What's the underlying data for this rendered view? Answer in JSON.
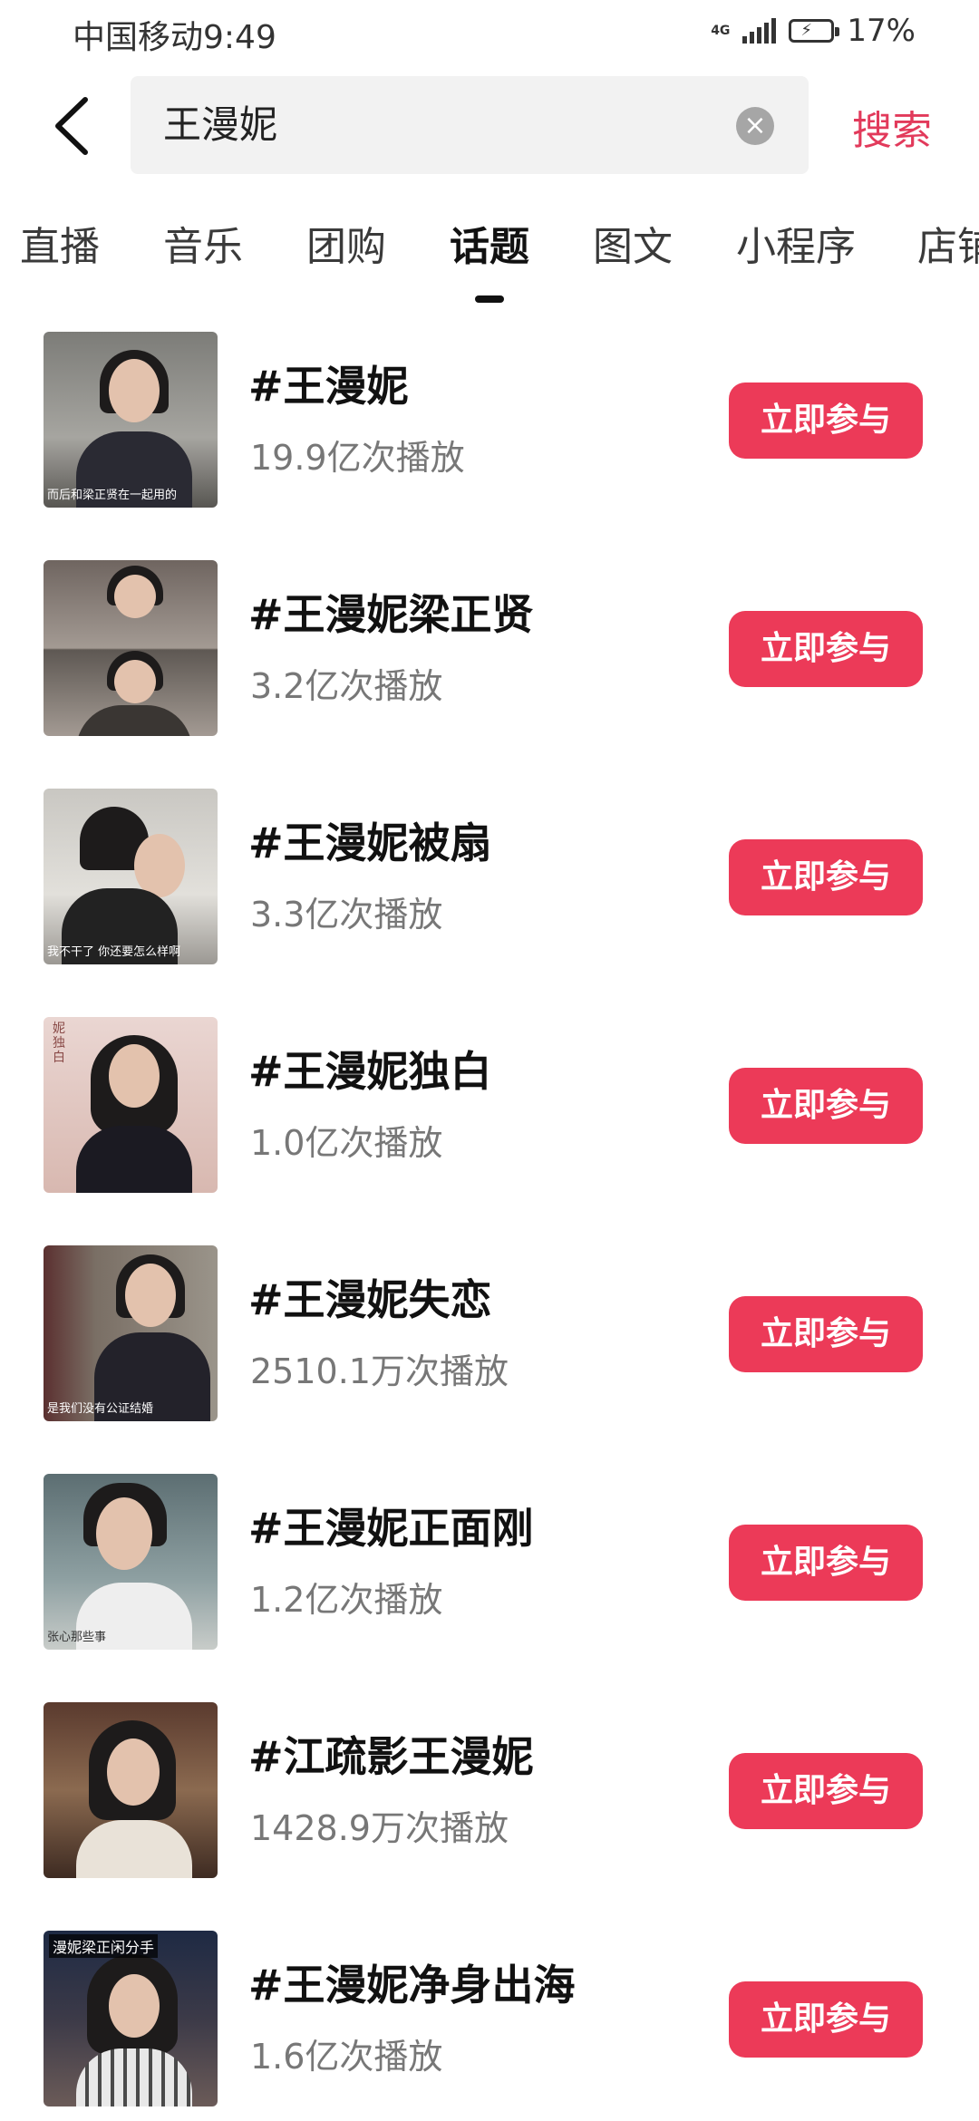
{
  "status_bar": {
    "carrier": "中国移动",
    "time": "9:49",
    "network": "4G",
    "battery": "17%"
  },
  "search": {
    "query": "王漫妮",
    "submit_label": "搜索"
  },
  "tabs": [
    {
      "label": "直播"
    },
    {
      "label": "音乐"
    },
    {
      "label": "团购"
    },
    {
      "label": "话题",
      "active": true
    },
    {
      "label": "图文"
    },
    {
      "label": "小程序"
    },
    {
      "label": "店铺"
    }
  ],
  "topics": [
    {
      "title": "#王漫妮",
      "plays": "19.9亿次播放",
      "join_label": "立即参与",
      "thumb_caption": "而后和梁正贤在一起用的"
    },
    {
      "title": "#王漫妮梁正贤",
      "plays": "3.2亿次播放",
      "join_label": "立即参与",
      "thumb_caption": ""
    },
    {
      "title": "#王漫妮被扇",
      "plays": "3.3亿次播放",
      "join_label": "立即参与",
      "thumb_caption": "我不干了 你还要怎么样啊"
    },
    {
      "title": "#王漫妮独白",
      "plays": "1.0亿次播放",
      "join_label": "立即参与",
      "thumb_caption": "妮独白"
    },
    {
      "title": "#王漫妮失恋",
      "plays": "2510.1万次播放",
      "join_label": "立即参与",
      "thumb_caption": "是我们没有公证结婚"
    },
    {
      "title": "#王漫妮正面刚",
      "plays": "1.2亿次播放",
      "join_label": "立即参与",
      "thumb_caption": "张心那些事"
    },
    {
      "title": "#江疏影王漫妮",
      "plays": "1428.9万次播放",
      "join_label": "立即参与",
      "thumb_caption": ""
    },
    {
      "title": "#王漫妮净身出海",
      "plays": "1.6亿次播放",
      "join_label": "立即参与",
      "thumb_caption": "漫妮梁正闲分手"
    }
  ],
  "colors": {
    "accent": "#ec3a58",
    "search_text": "#e23a5b"
  }
}
